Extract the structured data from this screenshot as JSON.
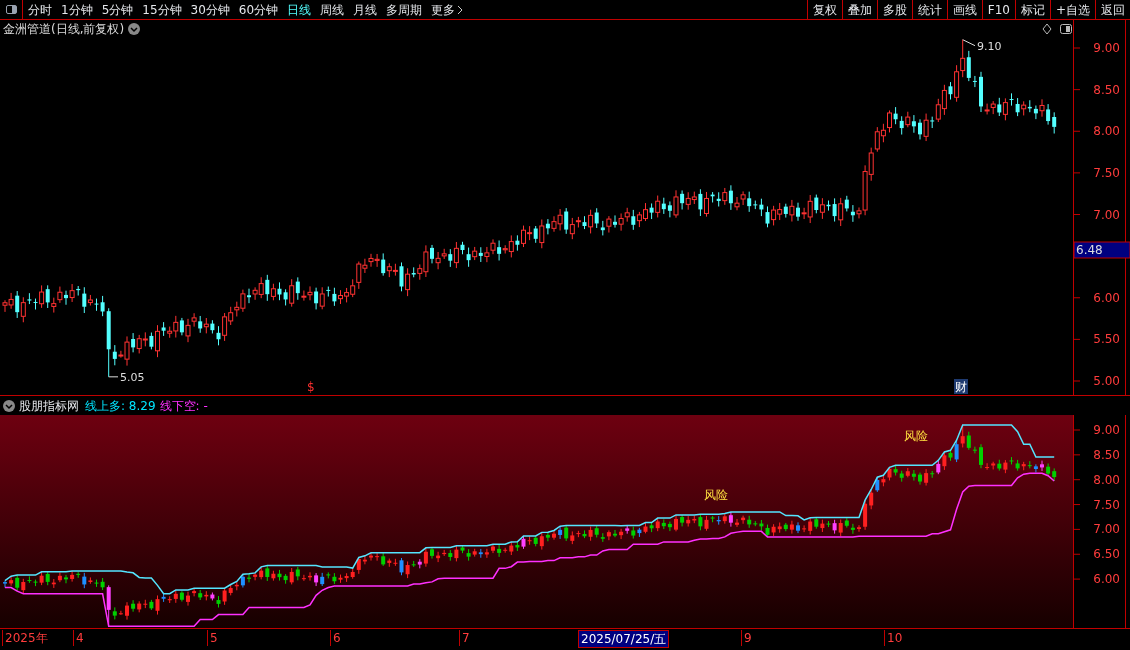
{
  "toolbar": {
    "periods": [
      {
        "label": "分时",
        "selected": false
      },
      {
        "label": "1分钟",
        "selected": false
      },
      {
        "label": "5分钟",
        "selected": false
      },
      {
        "label": "15分钟",
        "selected": false
      },
      {
        "label": "30分钟",
        "selected": false
      },
      {
        "label": "60分钟",
        "selected": false
      },
      {
        "label": "日线",
        "selected": true
      },
      {
        "label": "周线",
        "selected": false
      },
      {
        "label": "月线",
        "selected": false
      },
      {
        "label": "多周期",
        "selected": false
      },
      {
        "label": "更多",
        "selected": false
      }
    ],
    "buttons": [
      "复权",
      "叠加",
      "多股",
      "统计",
      "画线",
      "F10",
      "标记",
      "+自选",
      "返回"
    ]
  },
  "main_chart": {
    "title": "金洲管道(日线,前复权)",
    "yticks": [
      "9.00",
      "8.50",
      "8.00",
      "7.50",
      "7.00",
      "6.00",
      "5.50",
      "5.00"
    ],
    "high_label": "9.10",
    "low_label": "5.05",
    "current_price": "6.48",
    "markers": [
      {
        "kind": "symbol",
        "text": "$"
      },
      {
        "kind": "badge",
        "text": "财"
      }
    ]
  },
  "indicator": {
    "name": "股朋指标网",
    "legend": [
      {
        "label": "线上多: 8.29",
        "color": "#00e5ff"
      },
      {
        "label": "线下空: -",
        "color": "#ff30ff"
      }
    ],
    "yticks": [
      "9.00",
      "8.50",
      "8.00",
      "7.50",
      "7.00",
      "6.50",
      "6.00"
    ],
    "annotations": [
      "风险",
      "风险"
    ]
  },
  "x_axis": {
    "labels": [
      {
        "text": "2025年",
        "selected": false
      },
      {
        "text": "4",
        "selected": false
      },
      {
        "text": "5",
        "selected": false
      },
      {
        "text": "6",
        "selected": false
      },
      {
        "text": "7",
        "selected": false
      },
      {
        "text": "2025/07/25/五",
        "selected": true
      },
      {
        "text": "9",
        "selected": false
      },
      {
        "text": "10",
        "selected": false
      }
    ]
  }
}
